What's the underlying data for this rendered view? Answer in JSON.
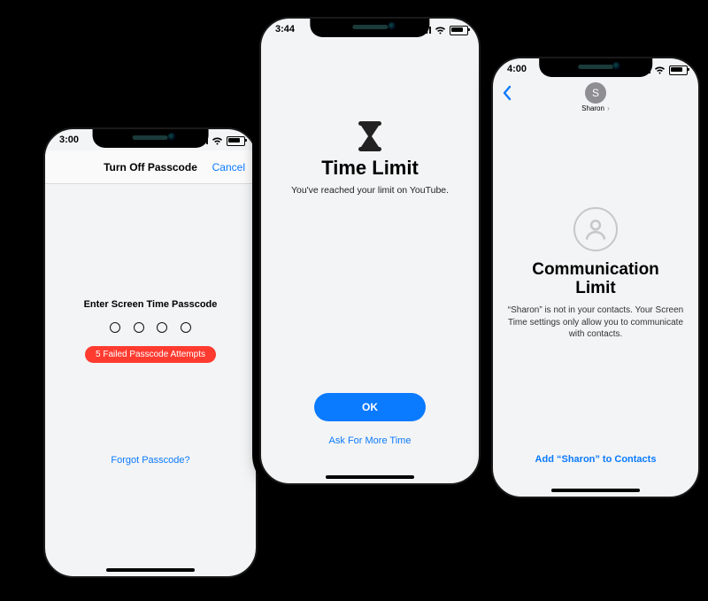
{
  "phone1": {
    "time": "3:00",
    "nav_title": "Turn Off Passcode",
    "cancel_label": "Cancel",
    "prompt": "Enter Screen Time Passcode",
    "error_badge": "5 Failed Passcode Attempts",
    "forgot_link": "Forgot Passcode?"
  },
  "phone2": {
    "time": "3:44",
    "headline": "Time Limit",
    "subtext": "You've reached your limit on YouTube.",
    "ok_label": "OK",
    "ask_more_label": "Ask For More Time"
  },
  "phone3": {
    "time": "4:00",
    "avatar_initial": "S",
    "contact_name": "Sharon",
    "headline": "Communication Limit",
    "subtext": "“Sharon” is not in your contacts. Your Screen Time settings only allow you to communicate with contacts.",
    "add_link": "Add “Sharon” to Contacts"
  }
}
